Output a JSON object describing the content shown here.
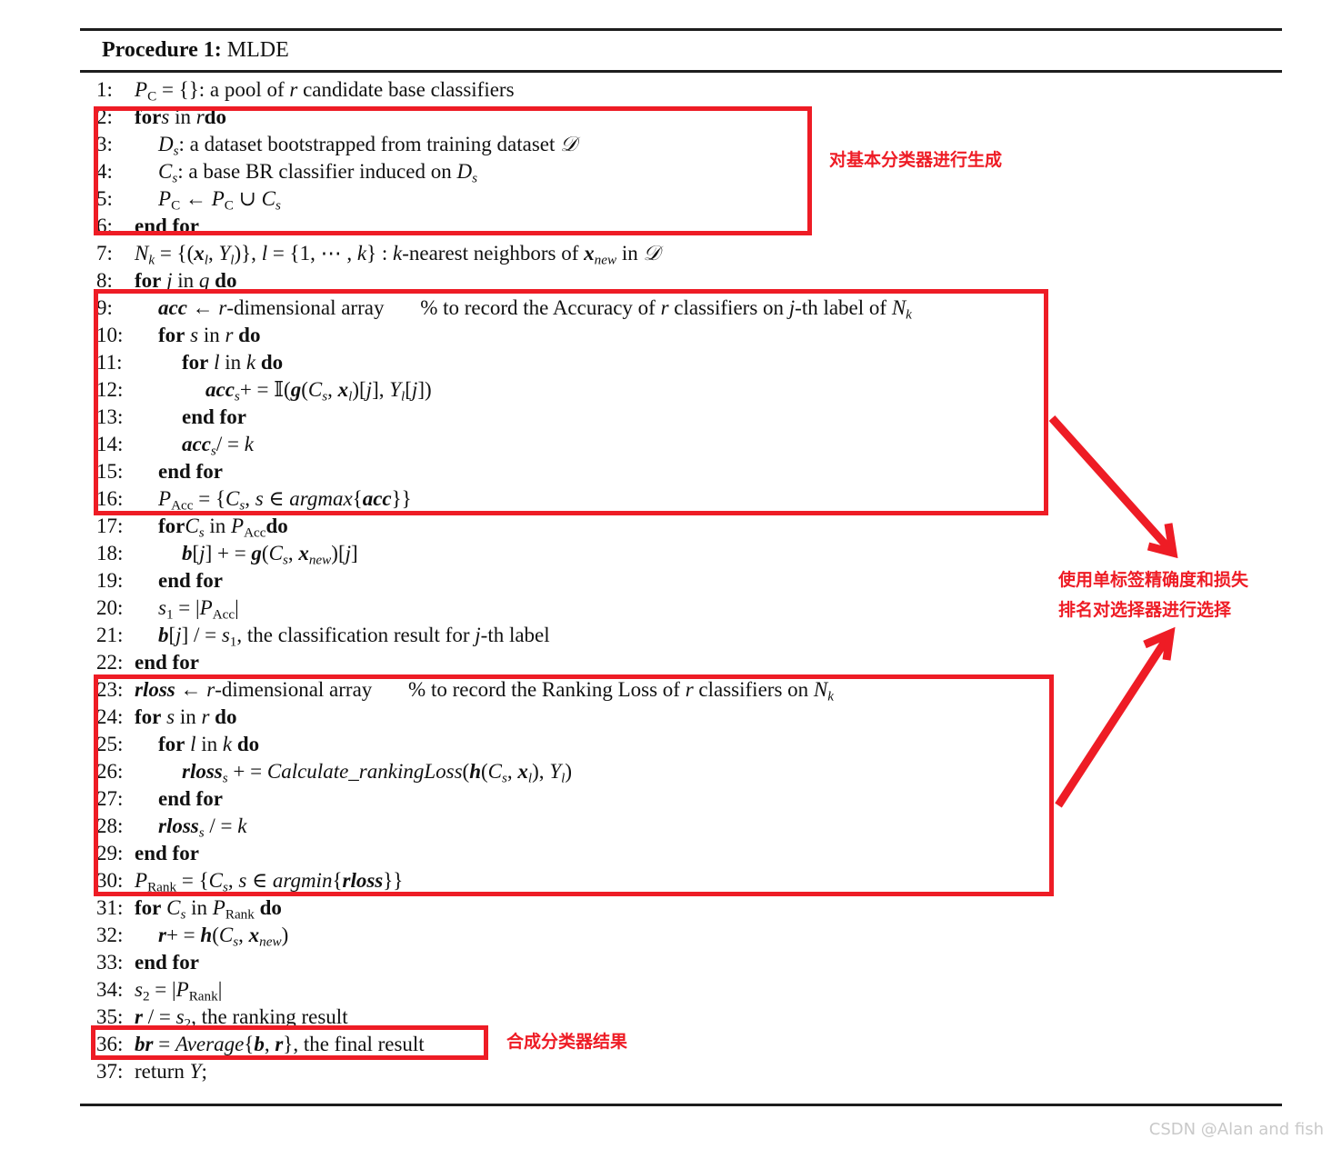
{
  "document": {
    "procedure_label": "Procedure 1:",
    "procedure_name": "MLDE",
    "watermark": "CSDN @Alan and fish"
  },
  "colors": {
    "annotation_red": "#ee1c25",
    "text_black": "#111111",
    "rule_black": "#1d1d1d",
    "watermark_grey": "#c9c9c9"
  },
  "algorithm": {
    "lines": [
      {
        "num": "1:",
        "text": "P_C = {}: a pool of r candidate base classifiers"
      },
      {
        "num": "2:",
        "text": "for s in r do"
      },
      {
        "num": "3:",
        "text": "D_s: a dataset bootstrapped from training dataset D"
      },
      {
        "num": "4:",
        "text": "C_s: a base BR classifier induced on D_s"
      },
      {
        "num": "5:",
        "text": "P_C <- P_C ∪ C_s"
      },
      {
        "num": "6:",
        "text": "end for"
      },
      {
        "num": "7:",
        "text": "N_k = {(x_l, Y_l)}, l = {1, ... , k} : k-nearest neighbors of x_new in D"
      },
      {
        "num": "8:",
        "text": "for j in q do"
      },
      {
        "num": "9:",
        "text": "acc <- r-dimensional array     % to record the Accuracy of r classifiers on j-th label of N_k"
      },
      {
        "num": "10:",
        "text": "for s in r do"
      },
      {
        "num": "11:",
        "text": "for l in k do"
      },
      {
        "num": "12:",
        "text": "acc_s+ = I(g(C_s, x_l)[j], Y_l[j])"
      },
      {
        "num": "13:",
        "text": "end for"
      },
      {
        "num": "14:",
        "text": "acc_s/ = k"
      },
      {
        "num": "15:",
        "text": "end for"
      },
      {
        "num": "16:",
        "text": "P_Acc = {C_s, s ∈ argmax{acc}}"
      },
      {
        "num": "17:",
        "text": "for C_s in P_Acc do"
      },
      {
        "num": "18:",
        "text": "b[j] + = g(C_s, x_new)[j]"
      },
      {
        "num": "19:",
        "text": "end for"
      },
      {
        "num": "20:",
        "text": "s_1 = |P_Acc|"
      },
      {
        "num": "21:",
        "text": "b[j] / = s_1, the classification result for j-th label"
      },
      {
        "num": "22:",
        "text": "end for"
      },
      {
        "num": "23:",
        "text": "rloss <- r-dimensional array     % to record the Ranking Loss of r classifiers on N_k"
      },
      {
        "num": "24:",
        "text": "for s in r do"
      },
      {
        "num": "25:",
        "text": "for l in k do"
      },
      {
        "num": "26:",
        "text": "rloss_s + = Calculate_rankingLoss(h(C_s, x_l), Y_l)"
      },
      {
        "num": "27:",
        "text": "end for"
      },
      {
        "num": "28:",
        "text": "rloss_s / = k"
      },
      {
        "num": "29:",
        "text": "end for"
      },
      {
        "num": "30:",
        "text": "P_Rank = {C_s, s ∈ argmin{rloss}}"
      },
      {
        "num": "31:",
        "text": "for C_s in P_Rank do"
      },
      {
        "num": "32:",
        "text": "r+ = h(C_s, x_new)"
      },
      {
        "num": "33:",
        "text": "end for"
      },
      {
        "num": "34:",
        "text": "s_2 = |P_Rank|"
      },
      {
        "num": "35:",
        "text": "r / = s_2, the ranking result"
      },
      {
        "num": "36:",
        "text": "br = Average{b, r}, the final result"
      },
      {
        "num": "37:",
        "text": "return Y;"
      }
    ]
  },
  "annotations": {
    "generation": "对基本分类器进行生成",
    "selection": "使用单标签精确度和损失\n排名对选择器进行选择",
    "combination": "合成分类器结果"
  }
}
